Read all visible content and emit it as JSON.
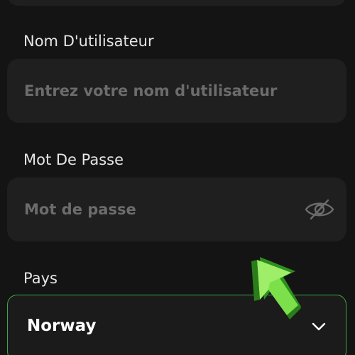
{
  "username": {
    "label": "Nom D'utilisateur",
    "placeholder": "Entrez votre nom d'utilisateur",
    "value": ""
  },
  "password": {
    "label": "Mot De Passe",
    "placeholder": "Mot de passe",
    "value": "",
    "toggle_icon": "eye-off-icon"
  },
  "country": {
    "label": "Pays",
    "selected": "Norway",
    "dropdown_icon": "chevron-down-icon"
  },
  "colors": {
    "background": "#141414",
    "field": "#1f1f1f",
    "placeholder": "#6c6c6c",
    "label": "#e6e6e6",
    "focus_border": "#3aa845",
    "cursor_arrow": "#5ec63a"
  }
}
